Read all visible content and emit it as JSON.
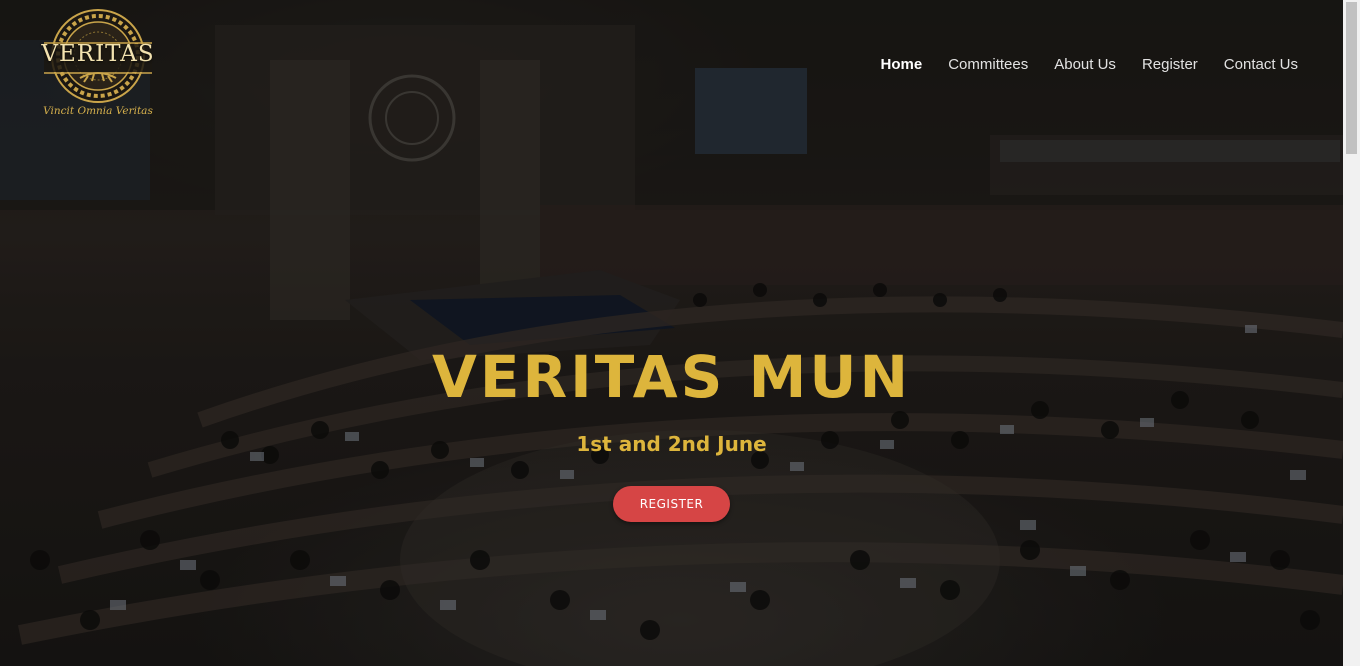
{
  "logo": {
    "name": "VERITAS",
    "motto": "Vincit Omnia Veritas"
  },
  "nav": {
    "items": [
      {
        "label": "Home",
        "active": true
      },
      {
        "label": "Committees",
        "active": false
      },
      {
        "label": "About Us",
        "active": false
      },
      {
        "label": "Register",
        "active": false
      },
      {
        "label": "Contact Us",
        "active": false
      }
    ]
  },
  "hero": {
    "title": "VERITAS MUN",
    "date": "1st and 2nd June",
    "button_label": "REGISTER",
    "background_description_icon": "assembly-hall-photo"
  },
  "colors": {
    "accent_gold": "#ddb53c",
    "button_red": "#d64545",
    "nav_text": "#e2e2e2"
  }
}
